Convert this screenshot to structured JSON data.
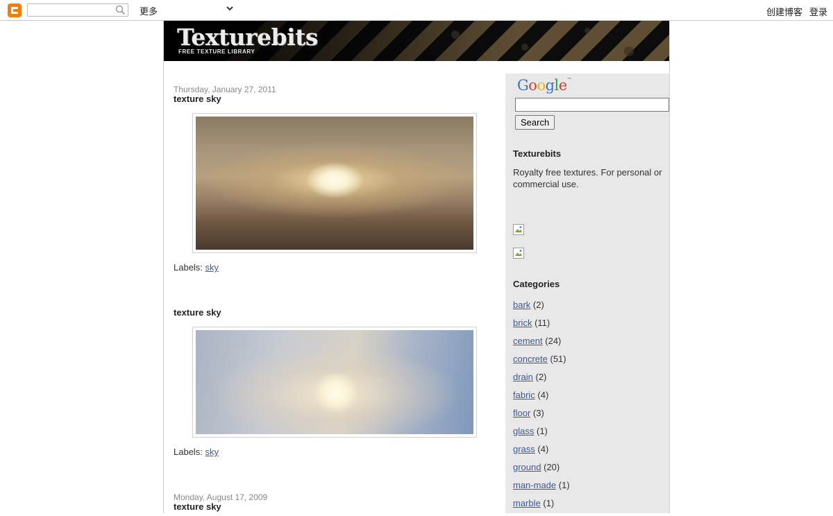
{
  "navbar": {
    "more_label": "更多",
    "create_blog_label": "创建博客",
    "login_label": "登录",
    "search_value": ""
  },
  "header": {
    "title": "Texturebits",
    "subtitle": "FREE TEXTURE LIBRARY"
  },
  "posts": [
    {
      "date": "Thursday, January 27, 2011",
      "title": "texture sky",
      "labels_prefix": "Labels:",
      "label": "sky"
    },
    {
      "date": "",
      "title": "texture sky",
      "labels_prefix": "Labels:",
      "label": "sky"
    },
    {
      "date": "Monday, August 17, 2009",
      "title": "texture sky"
    }
  ],
  "sidebar": {
    "google_search": {
      "logo_text": "Google",
      "query": "",
      "button_label": "Search"
    },
    "about": {
      "heading": "Texturebits",
      "description": "Royalty free textures. For personal or commercial use."
    },
    "categories": {
      "heading": "Categories",
      "items": [
        {
          "name": "bark",
          "count": "(2)"
        },
        {
          "name": "brick",
          "count": "(11)"
        },
        {
          "name": "cement",
          "count": "(24)"
        },
        {
          "name": "concrete",
          "count": "(51)"
        },
        {
          "name": "drain",
          "count": "(2)"
        },
        {
          "name": "fabric",
          "count": "(4)"
        },
        {
          "name": "floor",
          "count": "(3)"
        },
        {
          "name": "glass",
          "count": "(1)"
        },
        {
          "name": "grass",
          "count": "(4)"
        },
        {
          "name": "ground",
          "count": "(20)"
        },
        {
          "name": "man-made",
          "count": "(1)"
        },
        {
          "name": "marble",
          "count": "(1)"
        }
      ]
    }
  },
  "colors": {
    "link": "#3a5a98",
    "sidebar_bg": "#e8e8e8",
    "blogger_orange": "#f57d00"
  }
}
